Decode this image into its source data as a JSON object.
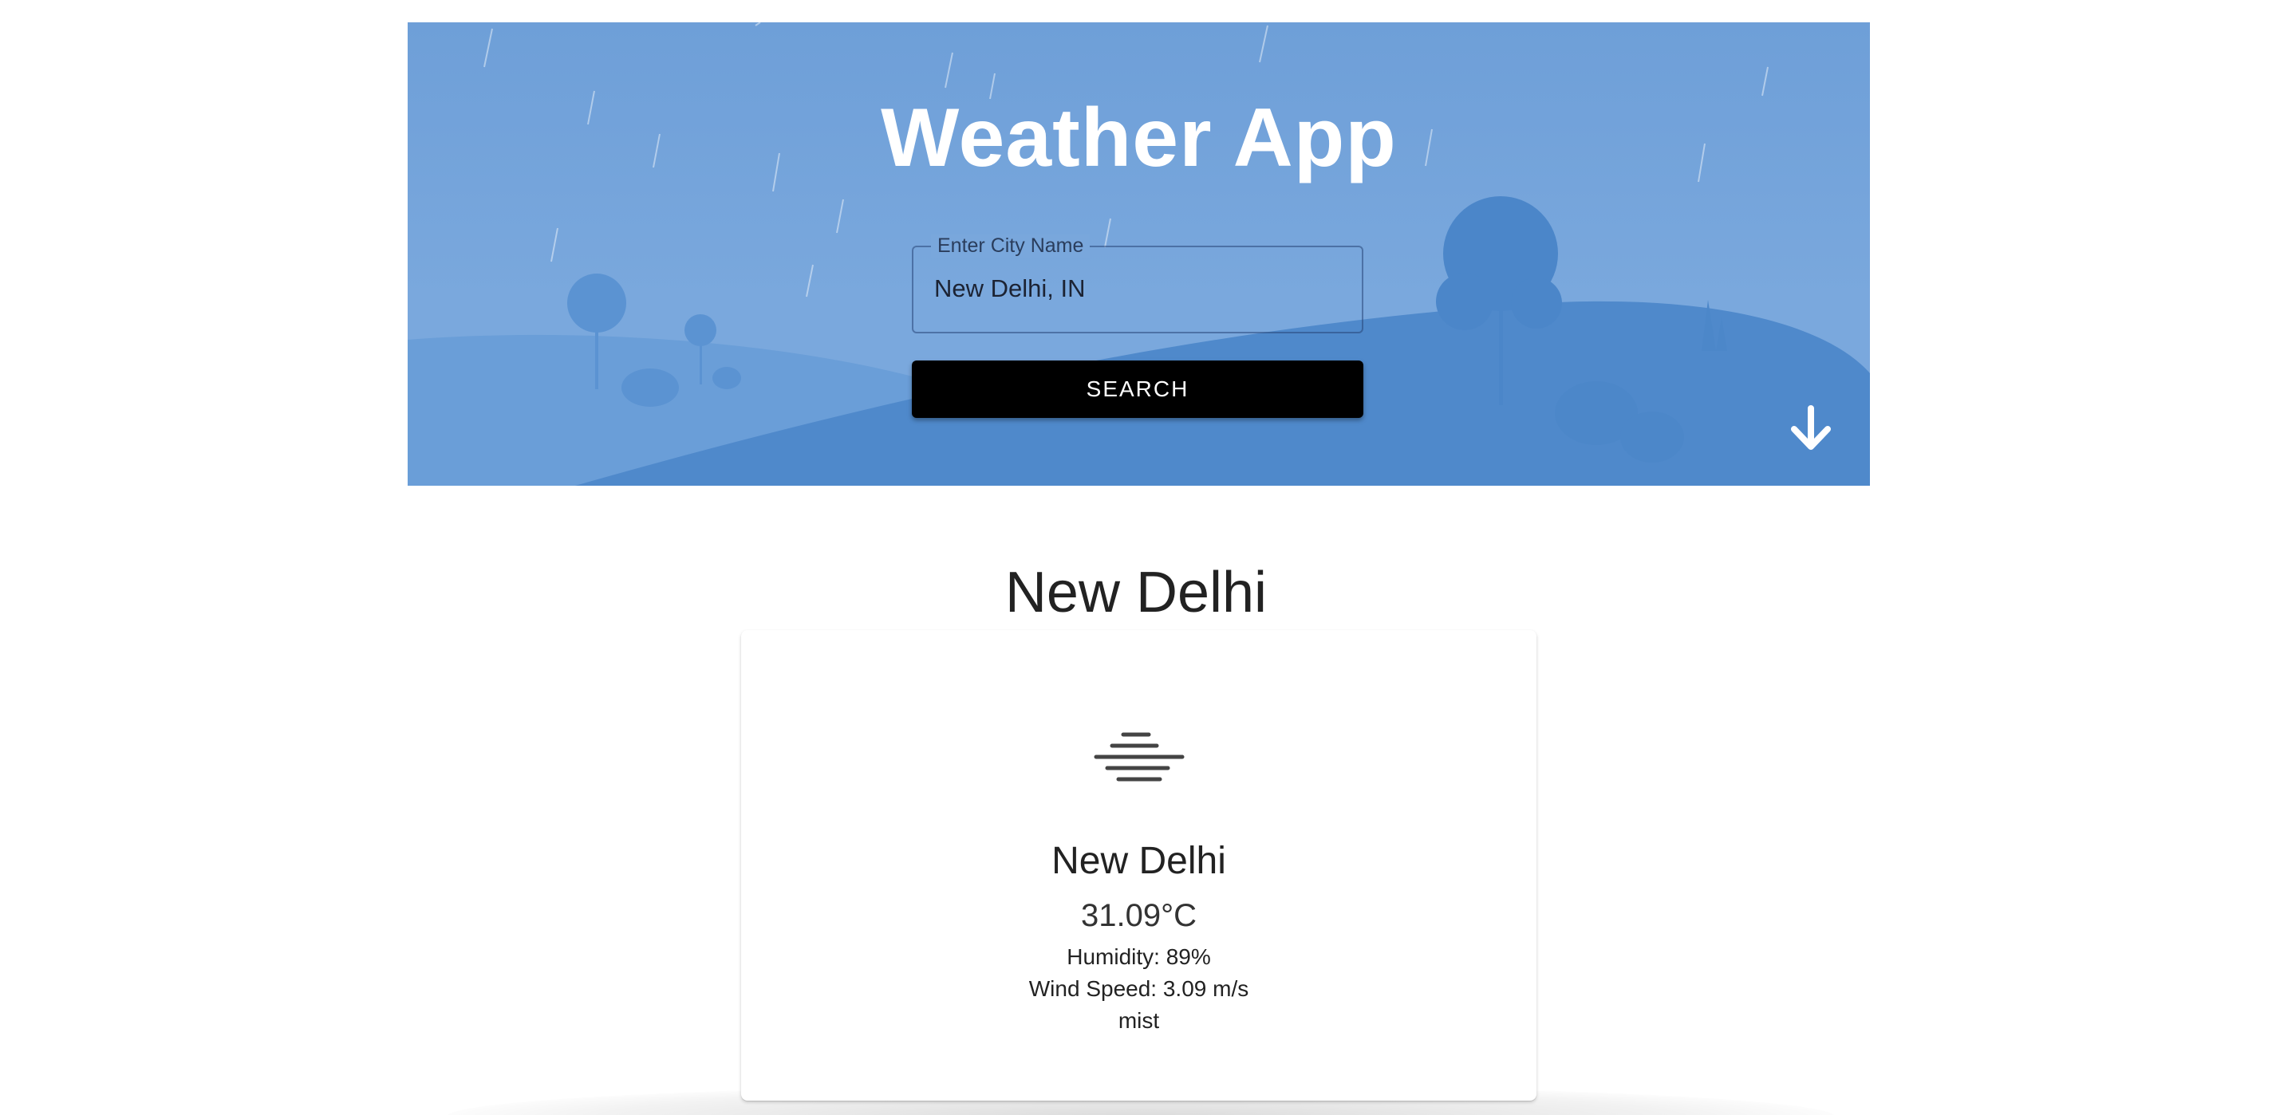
{
  "app": {
    "title": "Weather App"
  },
  "search": {
    "label": "Enter City Name",
    "value": "New Delhi, IN",
    "button_label": "SEARCH"
  },
  "result": {
    "heading": "New Delhi",
    "city": "New Delhi",
    "temperature": "31.09°C",
    "humidity": "Humidity: 89%",
    "wind_speed": "Wind Speed: 3.09 m/s",
    "description": "mist",
    "icon": "mist-icon"
  },
  "icons": {
    "scroll": "arrow-down-icon"
  },
  "colors": {
    "hero_sky": "#7aa8dd",
    "hero_hill": "#5089cb",
    "button": "#000000",
    "button_text": "#ffffff"
  }
}
